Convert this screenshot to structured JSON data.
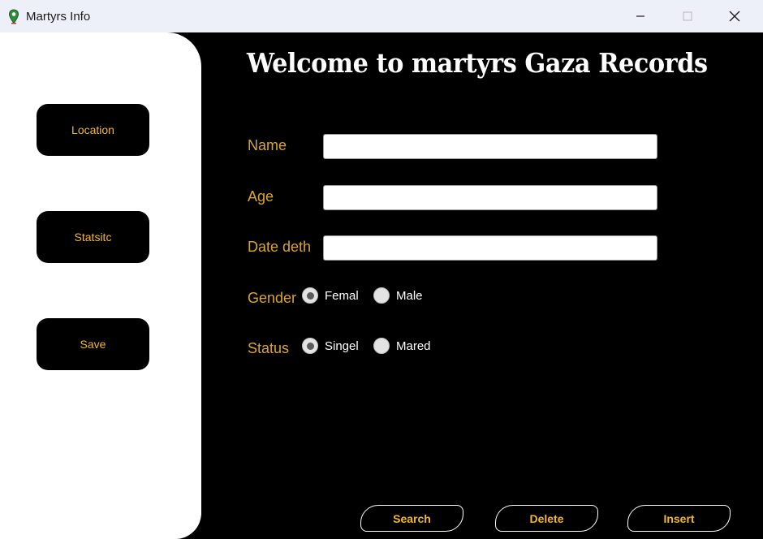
{
  "window": {
    "title": "Martyrs Info",
    "accent_color": "#f0b830",
    "label_color": "#d9a531"
  },
  "sidebar": {
    "items": [
      {
        "label": "Location"
      },
      {
        "label": "Statsitc"
      },
      {
        "label": "Save"
      }
    ]
  },
  "main": {
    "heading": "Welcome to  martyrs Gaza Records",
    "fields": {
      "name": {
        "label": "Name",
        "value": ""
      },
      "age": {
        "label": "Age",
        "value": ""
      },
      "date": {
        "label": "Date deth",
        "value": ""
      }
    },
    "gender": {
      "label": "Gender",
      "options": [
        {
          "label": "Femal",
          "selected": true
        },
        {
          "label": "Male",
          "selected": false
        }
      ]
    },
    "status": {
      "label": "Status",
      "options": [
        {
          "label": "Singel",
          "selected": true
        },
        {
          "label": "Mared",
          "selected": false
        }
      ]
    },
    "actions": {
      "search": "Search",
      "delete": "Delete",
      "insert": "Insert"
    }
  }
}
